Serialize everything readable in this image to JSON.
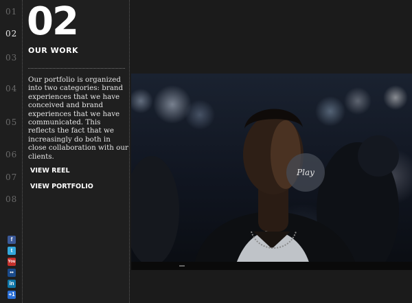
{
  "nav": {
    "numbers": [
      "01",
      "02",
      "03",
      "04",
      "05",
      "06",
      "07",
      "08"
    ],
    "active_index": 1
  },
  "section": {
    "number": "02",
    "title": "OUR WORK",
    "description": "Our portfolio is organized into two categories: brand experiences that we have conceived and brand experiences that we have communicated. This reflects the fact that we increasingly do both in close collaboration with our clients.",
    "links": [
      "VIEW REEL",
      "VIEW PORTFOLIO"
    ]
  },
  "social": [
    {
      "name": "facebook-icon",
      "glyph": "f",
      "color": "#3b5998"
    },
    {
      "name": "twitter-icon",
      "glyph": "t",
      "color": "#33a8dc"
    },
    {
      "name": "youtube-icon",
      "glyph": "You",
      "color": "#c4302b"
    },
    {
      "name": "flickr-icon",
      "glyph": "••",
      "color": "#1a4a8a"
    },
    {
      "name": "linkedin-icon",
      "glyph": "in",
      "color": "#0e76a8"
    },
    {
      "name": "delicious-icon",
      "glyph": "+1",
      "color": "#2a6fd6"
    }
  ],
  "video": {
    "play_label": "Play",
    "progress_fraction": 0.17
  }
}
